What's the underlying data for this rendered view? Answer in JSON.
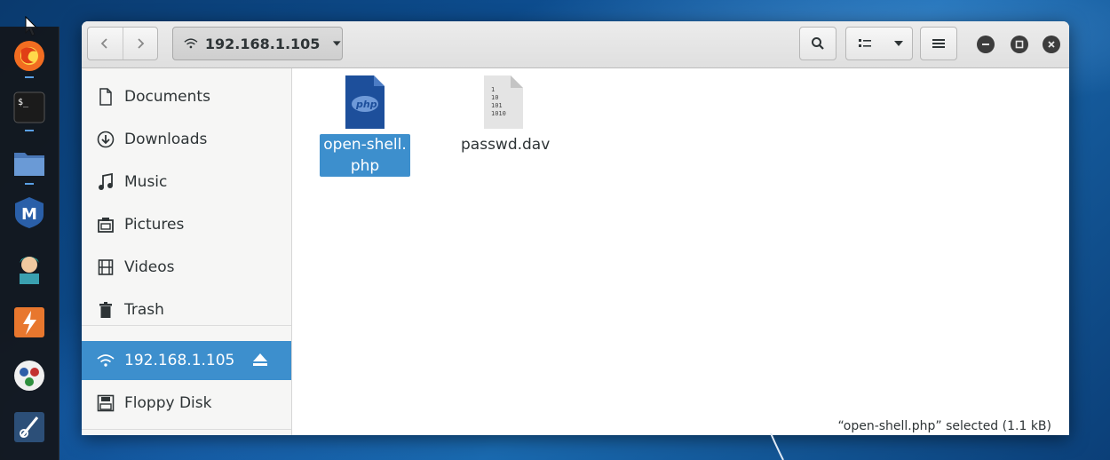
{
  "window": {
    "location": "192.168.1.105"
  },
  "toolbar": {
    "back_icon": "chevron-left-icon",
    "forward_icon": "chevron-right-icon",
    "search_icon": "search-icon",
    "view_icon": "list-view-icon",
    "menu_icon": "hamburger-menu-icon"
  },
  "sidebar": {
    "items": [
      {
        "label": "Documents",
        "icon": "document-icon"
      },
      {
        "label": "Downloads",
        "icon": "download-icon"
      },
      {
        "label": "Music",
        "icon": "music-icon"
      },
      {
        "label": "Pictures",
        "icon": "camera-icon"
      },
      {
        "label": "Videos",
        "icon": "film-icon"
      },
      {
        "label": "Trash",
        "icon": "trash-icon"
      }
    ],
    "network": {
      "label": "192.168.1.105",
      "icon": "wifi-icon",
      "active": true
    },
    "devices": [
      {
        "label": "Floppy Disk",
        "icon": "floppy-icon"
      }
    ]
  },
  "files": [
    {
      "name_line1": "open-shell.",
      "name_line2": "php",
      "icon": "php-file-icon",
      "selected": true
    },
    {
      "name": "passwd.dav",
      "icon": "binary-file-icon",
      "selected": false
    }
  ],
  "status": {
    "text": "“open-shell.php” selected  (1.1 kB)"
  },
  "colors": {
    "accent": "#3d8fcd",
    "php_icon": "#1d4f9b"
  }
}
